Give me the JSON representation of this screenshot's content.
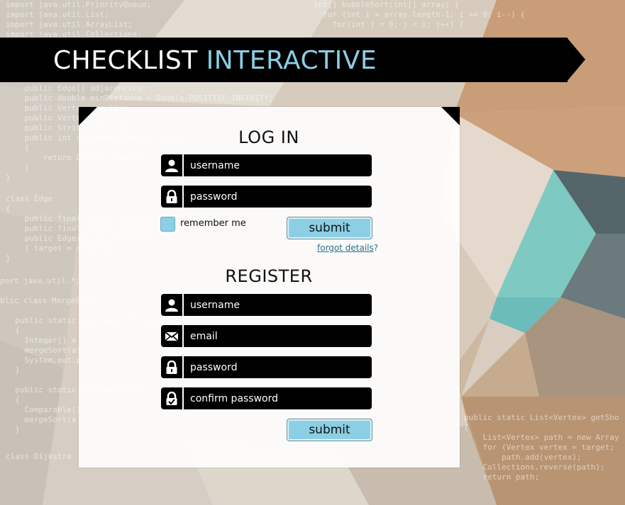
{
  "banner": {
    "title_main": "CHECKLIST",
    "title_accent": "INTERACTIVE"
  },
  "login": {
    "heading": "LOG IN",
    "username_placeholder": "username",
    "password_placeholder": "password",
    "remember_label": "remember me",
    "submit_label": "submit",
    "forgot_link": "forgot details",
    "forgot_suffix": "?"
  },
  "register": {
    "heading": "REGISTER",
    "username_placeholder": "username",
    "email_placeholder": "email",
    "password_placeholder": "password",
    "confirm_placeholder": "confirm password",
    "submit_label": "submit"
  },
  "background_code": [
    "import java.util.PriorityQueue;",
    "import java.util.List;",
    "import java.util.ArrayList;",
    "import java.util.Collections;",
    "int[] bubbleSort(int[] array) {",
    "  for (int i = array.length-1; i >= 0; i--) {",
    "    for(int j = 0; j < i; j++) {",
    "    public Edge[] adjacencies;",
    "    public double minDistance = Double.POSITIVE_INFINITY;",
    "    public Vertex previous;",
    "    public Vertex",
    "    public String toString()",
    "    public int compareTo(Vertex other)",
    "    {",
    "        return Double.compare",
    "    }",
    "}",
    "class Edge",
    "{",
    "    public final Vertex target;",
    "    public final double weight;",
    "    public Edge(Vertex argTarget,",
    "    { target = argTarget;",
    "}",
    "port java.util.*;",
    "blic class MergeSort",
    "  public static void main(String[]",
    "  {",
    "    Integer[] a",
    "    mergeSort(a)",
    "    System.out.println",
    "  }",
    "  public static void mergeSort",
    "  {",
    "    Comparable[]",
    "    mergeSort(a",
    "  }",
    "class Dijkstra",
    "public static List<Vertex> getSho",
    "{",
    "    List<Vertex> path = new Array",
    "    for (Vertex vertex = target;",
    "        path.add(vertex);",
    "    Collections.reverse(path);",
    "    return path;"
  ],
  "colors": {
    "accent": "#8ccfe4",
    "banner": "#000000",
    "panel": "#ffffff"
  },
  "icons": [
    "user-icon",
    "lock-icon",
    "envelope-icon",
    "lock-check-icon"
  ]
}
